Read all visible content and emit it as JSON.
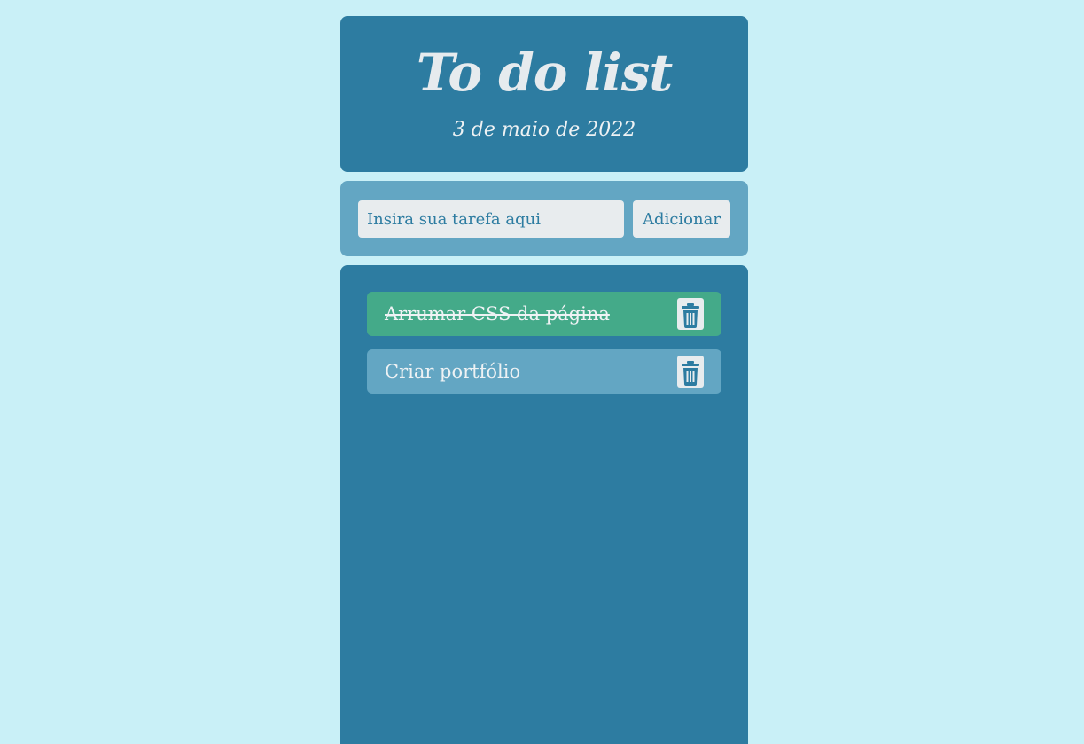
{
  "header": {
    "title": "To do list",
    "date": "3 de maio de 2022"
  },
  "form": {
    "input_value": "",
    "input_placeholder": "Insira sua tarefa aqui",
    "add_label": "Adicionar"
  },
  "tasks": [
    {
      "label": "Arrumar CSS da página",
      "done": true,
      "delete_icon": "trash-icon"
    },
    {
      "label": "Criar portfólio",
      "done": false,
      "delete_icon": "trash-icon"
    }
  ],
  "colors": {
    "page_bg": "#c9f0f7",
    "panel_bg": "#2d7ca1",
    "form_bg": "#63a6c3",
    "task_done_bg": "#44aa89",
    "task_bg": "#63a6c3",
    "control_bg": "#e8ecee",
    "text_light": "#eef2f4"
  }
}
